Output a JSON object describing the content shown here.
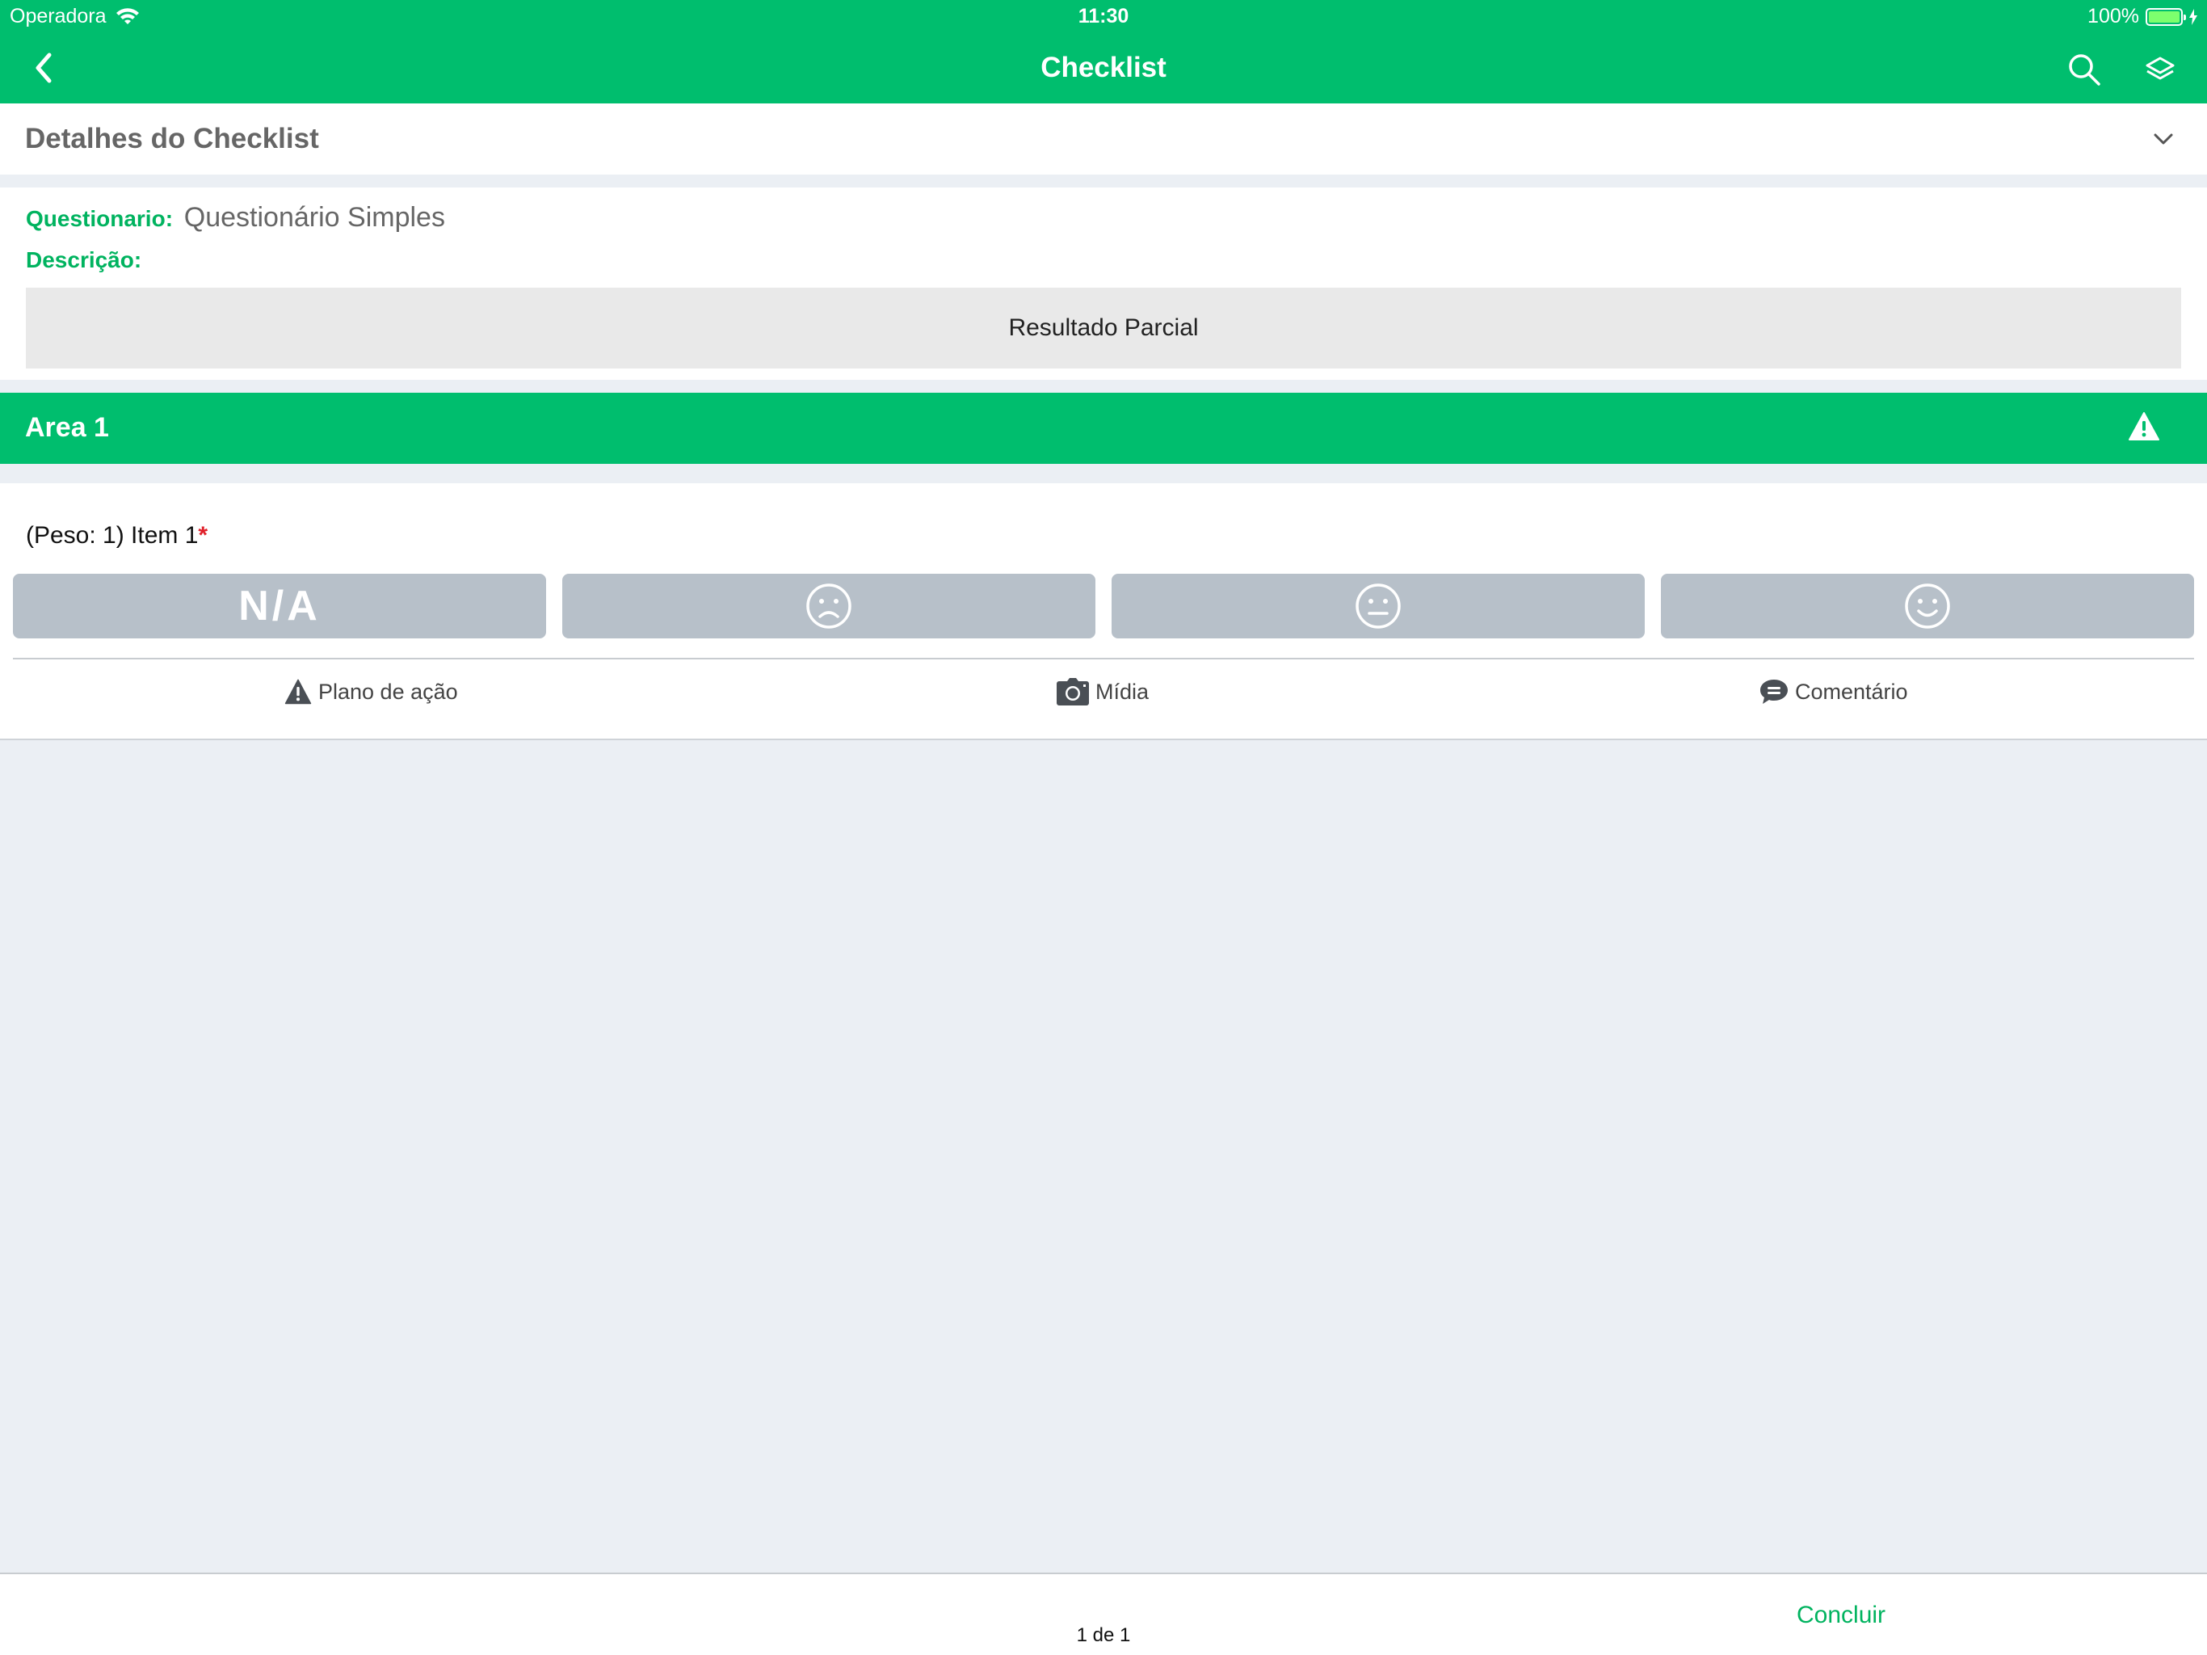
{
  "status_bar": {
    "carrier": "Operadora",
    "time": "11:30",
    "battery": "100%"
  },
  "nav": {
    "title": "Checklist",
    "back_icon": "chevron-left-icon",
    "search_icon": "search-icon",
    "layers_icon": "layers-icon"
  },
  "details": {
    "header": "Detalhes do Checklist",
    "questionario_label": "Questionario:",
    "questionario_value": "Questionário Simples",
    "descricao_label": "Descrição:",
    "result_button": "Resultado Parcial"
  },
  "area": {
    "title": "Area 1",
    "icon": "warning-icon"
  },
  "item": {
    "title": "(Peso: 1) Item 1",
    "required_mark": "*",
    "options": [
      {
        "label": "N/A",
        "icon": ""
      },
      {
        "label": "",
        "icon": "sad-face-icon"
      },
      {
        "label": "",
        "icon": "neutral-face-icon"
      },
      {
        "label": "",
        "icon": "happy-face-icon"
      }
    ],
    "actions": {
      "plano": "Plano de ação",
      "midia": "Mídia",
      "comentario": "Comentário"
    }
  },
  "footer": {
    "pager": "1 de 1",
    "concluir": "Concluir"
  },
  "colors": {
    "brand_green": "#00be6e",
    "button_gray": "#b7c0c9",
    "background": "#ebeff4"
  }
}
